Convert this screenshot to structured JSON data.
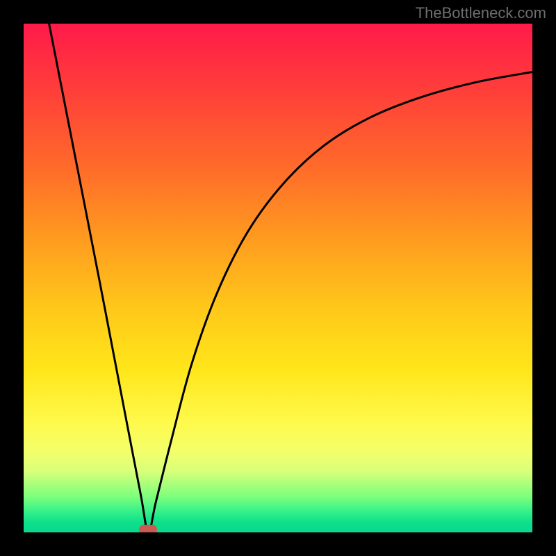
{
  "watermark": "TheBottleneck.com",
  "chart_data": {
    "type": "line",
    "title": "",
    "xlabel": "",
    "ylabel": "",
    "xlim": [
      0,
      1
    ],
    "ylim": [
      0,
      1
    ],
    "minimum": {
      "x": 0.245,
      "y": 0.0
    },
    "series": [
      {
        "name": "curve",
        "x": [
          0.05,
          0.1,
          0.15,
          0.2,
          0.23,
          0.245,
          0.26,
          0.29,
          0.33,
          0.38,
          0.44,
          0.51,
          0.59,
          0.68,
          0.78,
          0.89,
          1.0
        ],
        "y": [
          1.0,
          0.745,
          0.49,
          0.23,
          0.075,
          0.0,
          0.06,
          0.18,
          0.33,
          0.47,
          0.59,
          0.685,
          0.76,
          0.815,
          0.855,
          0.885,
          0.905
        ]
      }
    ],
    "marker": {
      "x": 0.245,
      "y": 0.005,
      "color": "#cc5a50"
    },
    "background_gradient": {
      "top": "#ff1a4a",
      "mid": "#ffe61a",
      "bottom": "#0ad890"
    }
  }
}
